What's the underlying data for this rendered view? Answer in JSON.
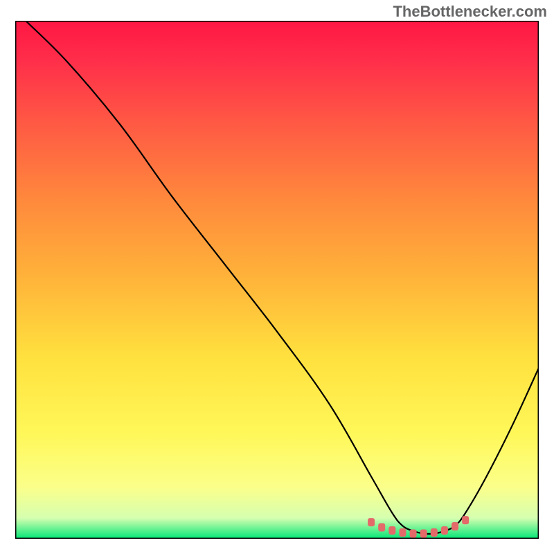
{
  "watermark": "TheBottlenecker.com",
  "chart_data": {
    "type": "line",
    "title": "",
    "xlabel": "",
    "ylabel": "",
    "xlim": [
      0,
      100
    ],
    "ylim": [
      0,
      100
    ],
    "series": [
      {
        "name": "curve",
        "x": [
          2,
          10,
          20,
          30,
          40,
          50,
          60,
          68,
          72,
          74,
          76,
          78,
          80,
          82,
          84,
          86,
          90,
          95,
          100
        ],
        "y": [
          100,
          92,
          80,
          66,
          53,
          40,
          26,
          12,
          5,
          2.5,
          1.5,
          1,
          1,
          1.5,
          2.5,
          5,
          12,
          22,
          33
        ]
      }
    ],
    "markers": {
      "name": "highlight-band",
      "x": [
        68,
        70,
        72,
        74,
        76,
        78,
        80,
        82,
        84,
        86
      ],
      "y": [
        3.2,
        2.2,
        1.6,
        1.2,
        1.0,
        1.0,
        1.2,
        1.6,
        2.4,
        3.6
      ]
    },
    "gradient_stops": [
      {
        "offset": 0.0,
        "color": "#ff1744"
      },
      {
        "offset": 0.08,
        "color": "#ff2f4a"
      },
      {
        "offset": 0.2,
        "color": "#ff5a44"
      },
      {
        "offset": 0.35,
        "color": "#ff8a3c"
      },
      {
        "offset": 0.5,
        "color": "#ffb43a"
      },
      {
        "offset": 0.65,
        "color": "#ffe13e"
      },
      {
        "offset": 0.8,
        "color": "#fff85a"
      },
      {
        "offset": 0.9,
        "color": "#fbff8a"
      },
      {
        "offset": 0.96,
        "color": "#d6ffb0"
      },
      {
        "offset": 1.0,
        "color": "#00e676"
      }
    ],
    "frame_stroke": "#000000",
    "curve_stroke": "#000000",
    "marker_fill": "#e46a6a"
  }
}
